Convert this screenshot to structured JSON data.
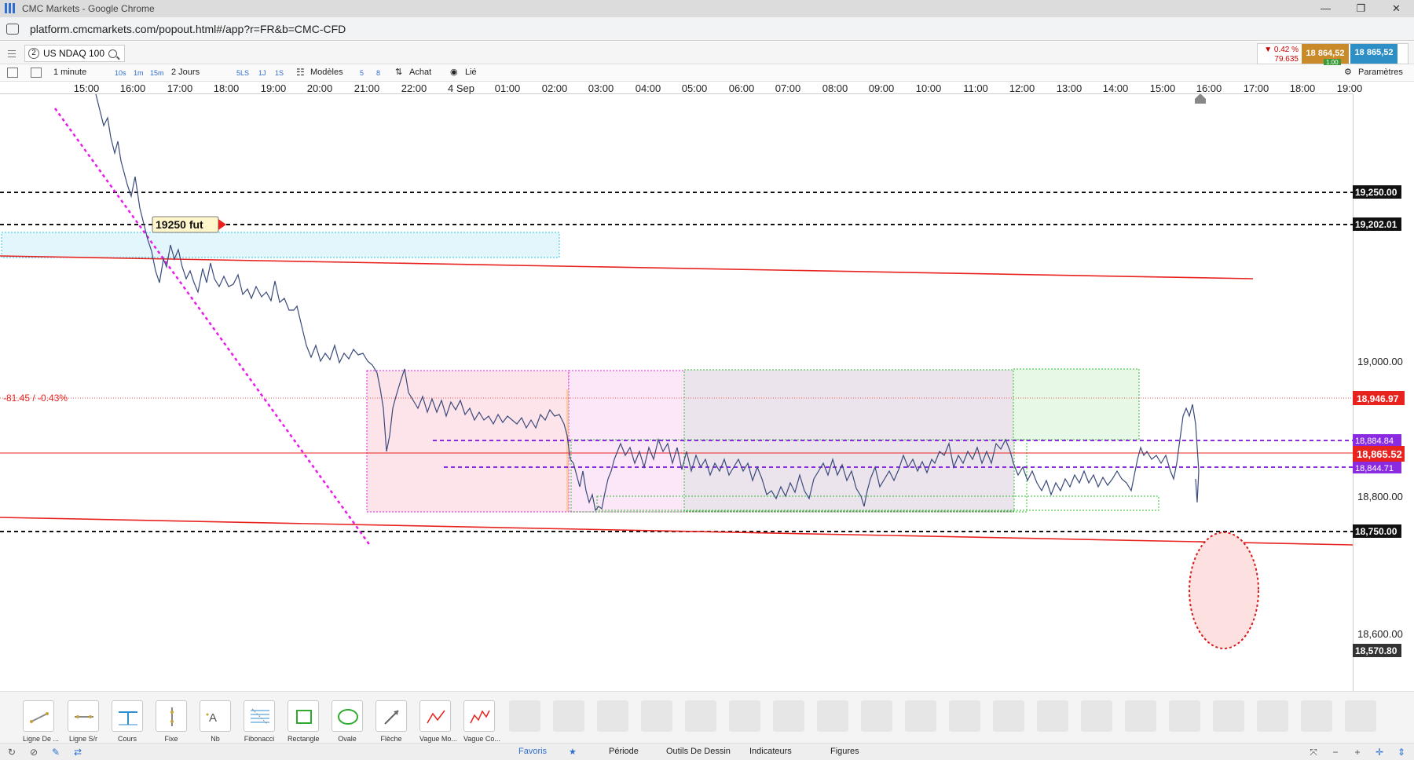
{
  "window": {
    "title": "CMC Markets - Google Chrome",
    "url": "platform.cmcmarkets.com/popout.html#/app?r=FR&b=CMC-CFD"
  },
  "instrument": {
    "number": "2",
    "name": "US NDAQ 100"
  },
  "quote": {
    "change_pct": "▼ 0.42 %",
    "change_abs": "79.635",
    "sell": "18 864,52",
    "buy": "18 865,52",
    "spread": "1.00"
  },
  "toolbar": {
    "interval": "1 minute",
    "intervals": [
      "10s",
      "1m",
      "15m"
    ],
    "range": "2 Jours",
    "ranges": [
      "5LS",
      "1J",
      "1S"
    ],
    "templates_label": "Modèles",
    "num_5": "5",
    "num_8": "8",
    "buy_label": "Achat",
    "link_label": "Lié",
    "settings_label": "Paramètres"
  },
  "time_axis": [
    "15:00",
    "16:00",
    "17:00",
    "18:00",
    "19:00",
    "20:00",
    "21:00",
    "22:00",
    "4 Sep",
    "01:00",
    "02:00",
    "03:00",
    "04:00",
    "05:00",
    "06:00",
    "07:00",
    "08:00",
    "09:00",
    "10:00",
    "11:00",
    "12:00",
    "13:00",
    "14:00",
    "15:00",
    "16:00",
    "17:00",
    "18:00",
    "19:00"
  ],
  "price_axis": {
    "ticks": [
      "19,000.00",
      "18,800.00",
      "18,600.00"
    ],
    "labels": {
      "l19250": "19,250.00",
      "l19202": "19,202.01",
      "l18946": "18,946.97",
      "l18884": "18,884.84",
      "l18865": "18,865.52",
      "l18844": "18,844.71",
      "l18750": "18,750.00",
      "l18570": "18,570.80"
    }
  },
  "annotations": {
    "fut_label": "19250  fut",
    "change_label": "-81.45 / -0.43%"
  },
  "colors": {
    "red": "#e8231f",
    "magenta": "#e81ce8",
    "purple": "#8a2be2",
    "sell": "#c98a2a",
    "buy": "#2d8fc6"
  },
  "drawing_tools": [
    {
      "label": "Ligne De ...",
      "icon": "trend-line-icon"
    },
    {
      "label": "Ligne S/r",
      "icon": "sr-line-icon"
    },
    {
      "label": "Cours",
      "icon": "price-line-icon"
    },
    {
      "label": "Fixe",
      "icon": "fixed-line-icon"
    },
    {
      "label": "Nb",
      "icon": "text-icon"
    },
    {
      "label": "Fibonacci",
      "icon": "fibonacci-icon"
    },
    {
      "label": "Rectangle",
      "icon": "rectangle-icon"
    },
    {
      "label": "Ovale",
      "icon": "oval-icon"
    },
    {
      "label": "Flèche",
      "icon": "arrow-icon"
    },
    {
      "label": "Vague Mo...",
      "icon": "wave-icon"
    },
    {
      "label": "Vague Co...",
      "icon": "wave-co-icon"
    }
  ],
  "bottom_tabs": {
    "favoris": "Favoris",
    "periode": "Période",
    "outils": "Outils De Dessin",
    "indicateurs": "Indicateurs",
    "figures": "Figures"
  }
}
